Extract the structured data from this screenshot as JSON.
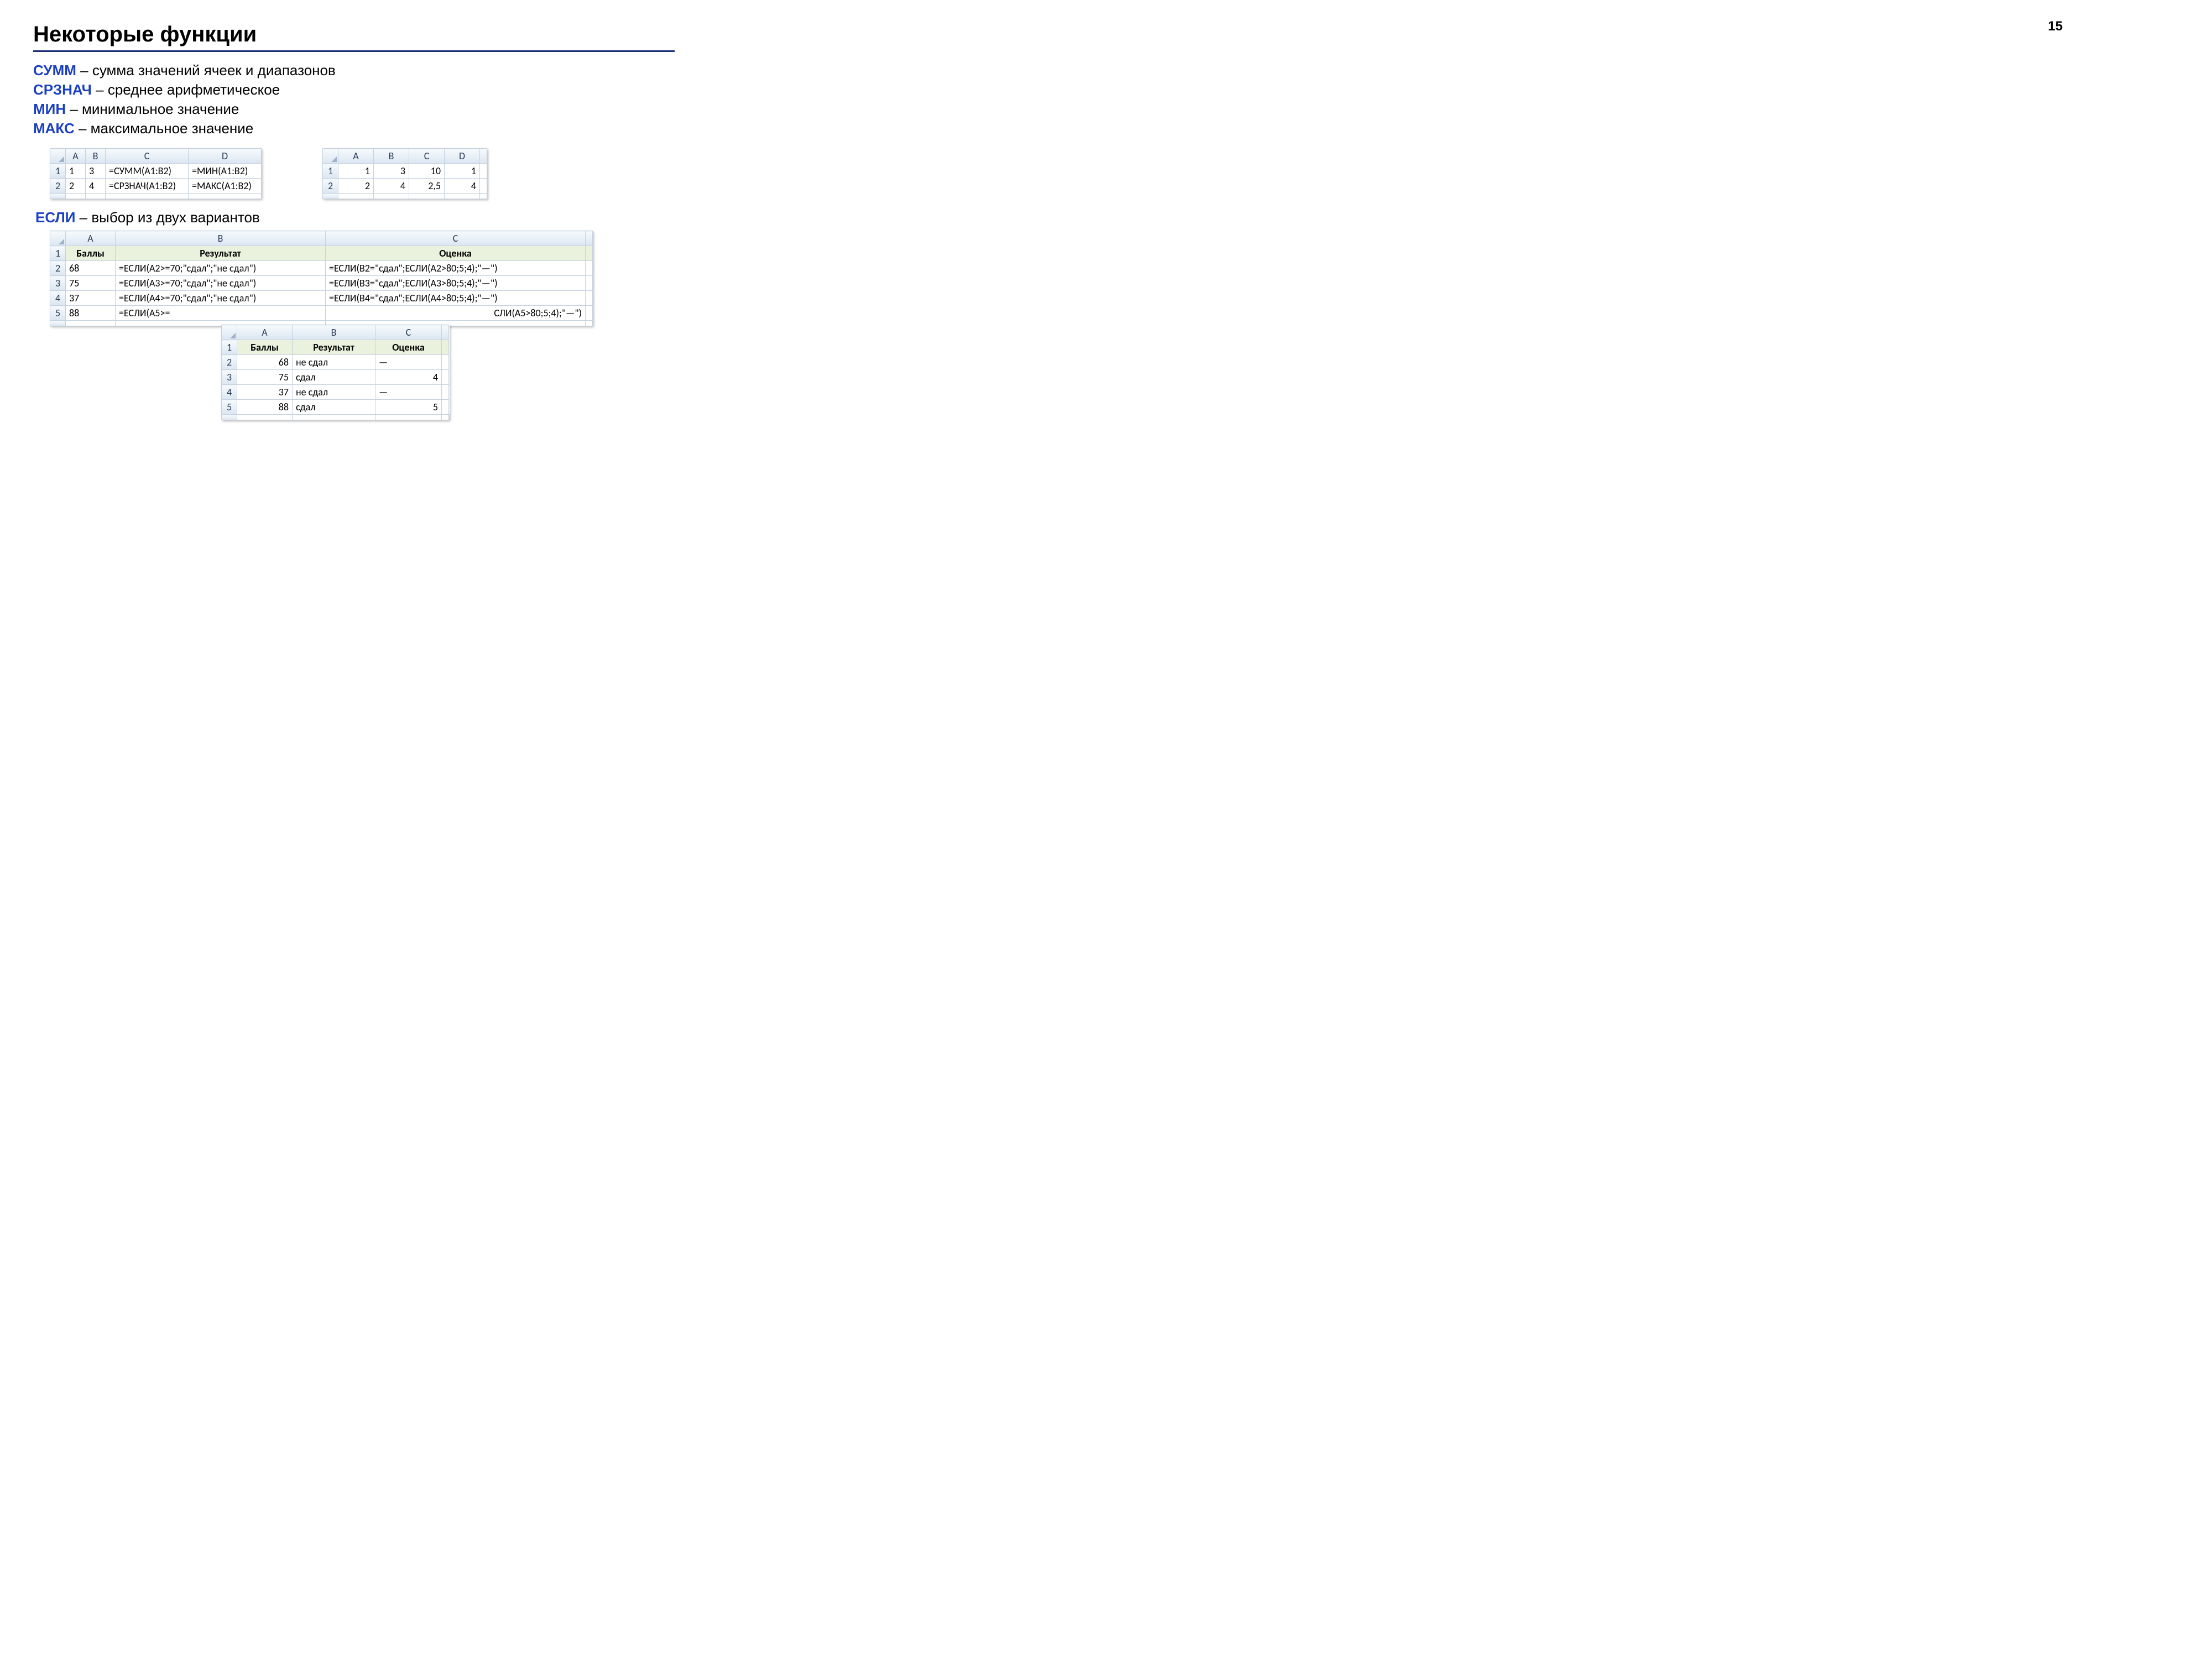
{
  "page_number": "15",
  "title": "Некоторые функции",
  "functions": [
    {
      "name": "СУММ",
      "desc": " – сумма значений ячеек и диапазонов"
    },
    {
      "name": "СРЗНАЧ",
      "desc": " – среднее арифметическое"
    },
    {
      "name": "МИН",
      "desc": " – минимальное значение"
    },
    {
      "name": "МАКС",
      "desc": " – максимальное значение"
    }
  ],
  "if_head": {
    "name": "ЕСЛИ",
    "desc": " – выбор из двух вариантов"
  },
  "table1": {
    "cols": [
      "A",
      "B",
      "C",
      "D"
    ],
    "rows": [
      [
        "1",
        "1",
        "3",
        "=СУММ(A1:B2)",
        "=МИН(A1:B2)"
      ],
      [
        "2",
        "2",
        "4",
        "=СРЗНАЧ(A1:B2)",
        "=МАКС(A1:B2)"
      ]
    ]
  },
  "table2": {
    "cols": [
      "A",
      "B",
      "C",
      "D"
    ],
    "rows": [
      [
        "1",
        "1",
        "3",
        "10",
        "1"
      ],
      [
        "2",
        "2",
        "4",
        "2,5",
        "4"
      ]
    ]
  },
  "table3": {
    "cols": [
      "A",
      "B",
      "C"
    ],
    "header_row": [
      "1",
      "Баллы",
      "Результат",
      "Оценка"
    ],
    "rows": [
      [
        "2",
        "68",
        "=ЕСЛИ(A2>=70;\"сдал\";\"не сдал\")",
        "=ЕСЛИ(B2=\"сдал\";ЕСЛИ(A2>80;5;4);\"—\")"
      ],
      [
        "3",
        "75",
        "=ЕСЛИ(A3>=70;\"сдал\";\"не сдал\")",
        "=ЕСЛИ(B3=\"сдал\";ЕСЛИ(A3>80;5;4);\"—\")"
      ],
      [
        "4",
        "37",
        "=ЕСЛИ(A4>=70;\"сдал\";\"не сдал\")",
        "=ЕСЛИ(B4=\"сдал\";ЕСЛИ(A4>80;5;4);\"—\")"
      ],
      [
        "5",
        "88",
        "=ЕСЛИ(A5>=",
        "СЛИ(A5>80;5;4);\"—\")"
      ]
    ]
  },
  "table4": {
    "cols": [
      "A",
      "B",
      "C"
    ],
    "header_row": [
      "1",
      "Баллы",
      "Результат",
      "Оценка"
    ],
    "rows": [
      [
        "2",
        "68",
        "не сдал",
        "—"
      ],
      [
        "3",
        "75",
        "сдал",
        "4"
      ],
      [
        "4",
        "37",
        "не сдал",
        "—"
      ],
      [
        "5",
        "88",
        "сдал",
        "5"
      ]
    ]
  }
}
